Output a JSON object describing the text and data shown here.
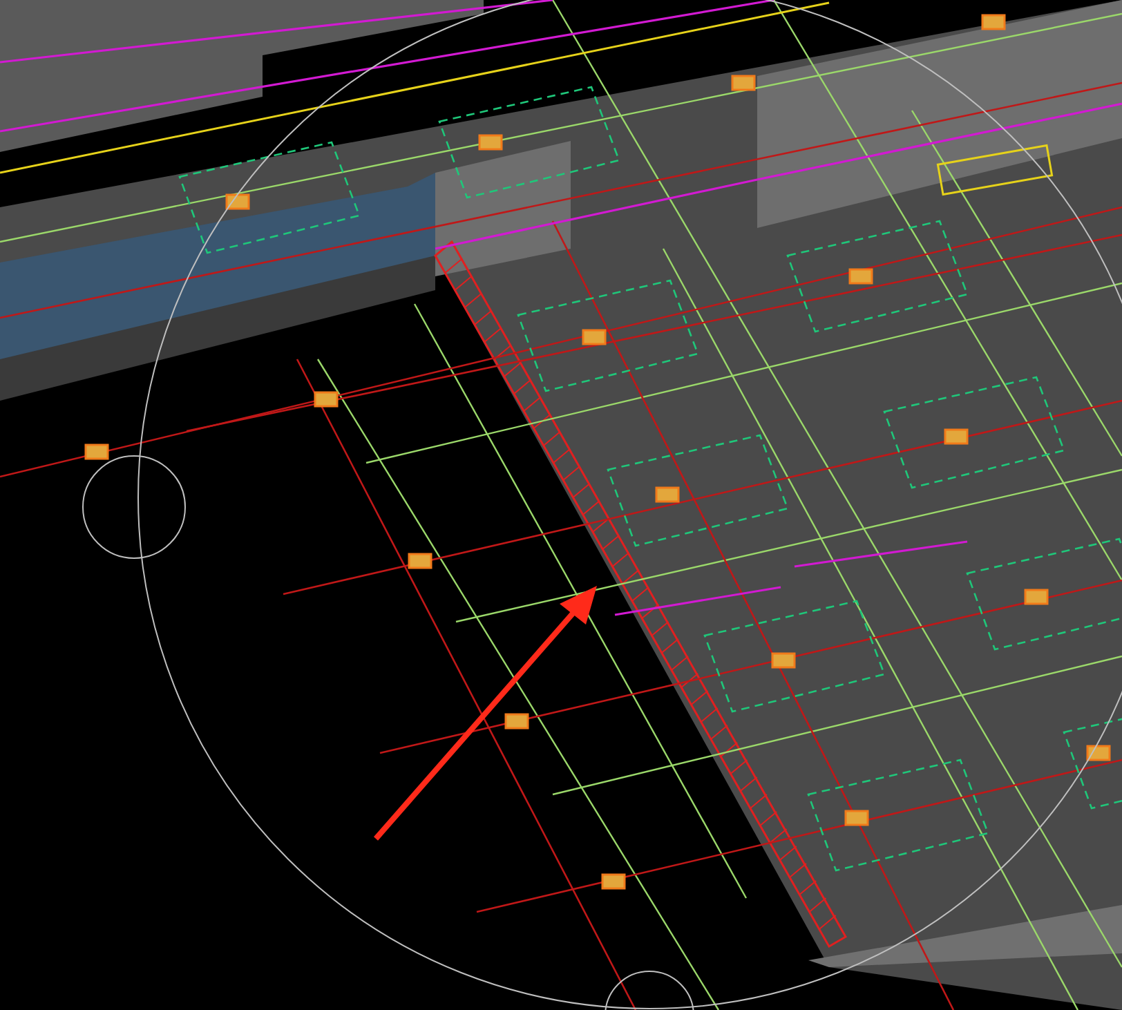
{
  "annotation": {
    "kind": "arrow",
    "color": "#ff2a1a"
  }
}
